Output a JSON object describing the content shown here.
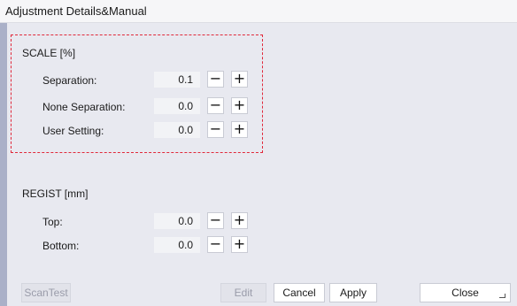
{
  "window": {
    "title": "Adjustment Details&Manual"
  },
  "scale": {
    "title": "SCALE [%]",
    "rows": [
      {
        "label": "Separation:",
        "value": "0.1",
        "minus": "−",
        "plus": "+"
      },
      {
        "label": "None Separation:",
        "value": "0.0",
        "minus": "−",
        "plus": "+"
      },
      {
        "label": "User Setting:",
        "value": "0.0",
        "minus": "−",
        "plus": "+"
      }
    ]
  },
  "regist": {
    "title": "REGIST [mm]",
    "rows": [
      {
        "label": "Top:",
        "value": "0.0",
        "minus": "−",
        "plus": "+"
      },
      {
        "label": "Bottom:",
        "value": "0.0",
        "minus": "−",
        "plus": "+"
      }
    ]
  },
  "footer": {
    "scantest_label": "ScanTest",
    "edit_label": "Edit",
    "cancel_label": "Cancel",
    "apply_label": "Apply",
    "close_label": "Close"
  },
  "colors": {
    "highlight_border": "#e0283a",
    "left_strip": "#aab0c8",
    "background": "#e8e9f0"
  }
}
